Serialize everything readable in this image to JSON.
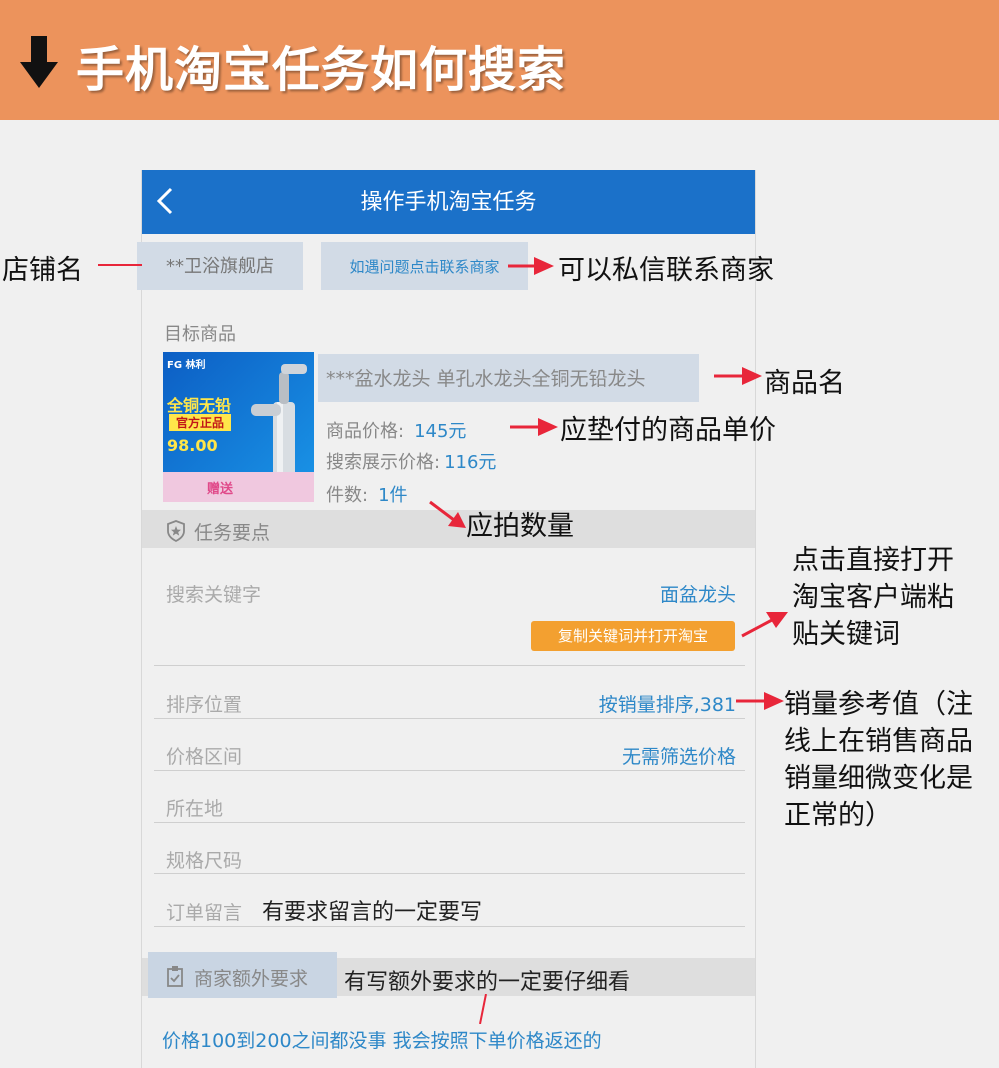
{
  "banner": {
    "title": "手机淘宝任务如何搜索",
    "bg_color": "#ec935c",
    "arrow_icon": "down-arrow-icon"
  },
  "appbar": {
    "title": "操作手机淘宝任务",
    "bg_color": "#1b71c9",
    "back_icon": "chevron-left-icon"
  },
  "shop": {
    "name": "**卫浴旗舰店",
    "contact_label": "如遇问题点击联系商家"
  },
  "product": {
    "section_label": "目标商品",
    "name": "***盆水龙头 单孔水龙头全铜无铅龙头",
    "price_label": "商品价格:",
    "price_value": "145元",
    "search_price_label": "搜索展示价格:",
    "search_price_value": "116元",
    "quantity_label": "件数:",
    "quantity_value": "1件",
    "image": {
      "brand": "FG 林利",
      "headline_1": "全铜无铅",
      "headline_2": "官方正品",
      "price": "98.00",
      "gift": "赠送"
    }
  },
  "task_points": {
    "section_label": "任务要点",
    "rows": [
      {
        "label": "搜索关键字",
        "value": "面盆龙头"
      },
      {
        "label": "排序位置",
        "value": "按销量排序,381"
      },
      {
        "label": "价格区间",
        "value": "无需筛选价格"
      },
      {
        "label": "所在地",
        "value": ""
      },
      {
        "label": "规格尺码",
        "value": ""
      },
      {
        "label": "订单留言",
        "value": ""
      }
    ],
    "copy_button": "复制关键词并打开淘宝"
  },
  "merchant_extra": {
    "section_label": "商家额外要求",
    "note": "价格100到200之间都没事  我会按照下单价格返还的"
  },
  "annotations": {
    "shop_name": "店铺名",
    "contact": "可以私信联系商家",
    "product_name": "商品名",
    "unit_price": "应垫付的商品单价",
    "quantity": "应拍数量",
    "open_taobao": [
      "点击直接打开",
      "淘宝客户端粘",
      "贴关键词"
    ],
    "sales_ref": [
      "销量参考值（注",
      "线上在销售商品",
      "销量细微变化是",
      "正常的）"
    ],
    "order_note": "有要求留言的一定要写",
    "extra": "有写额外要求的一定要仔细看"
  },
  "colors": {
    "accent_blue": "#2e88c8",
    "annotation_arrow": "#e8263a",
    "copy_button": "#f3a030"
  }
}
